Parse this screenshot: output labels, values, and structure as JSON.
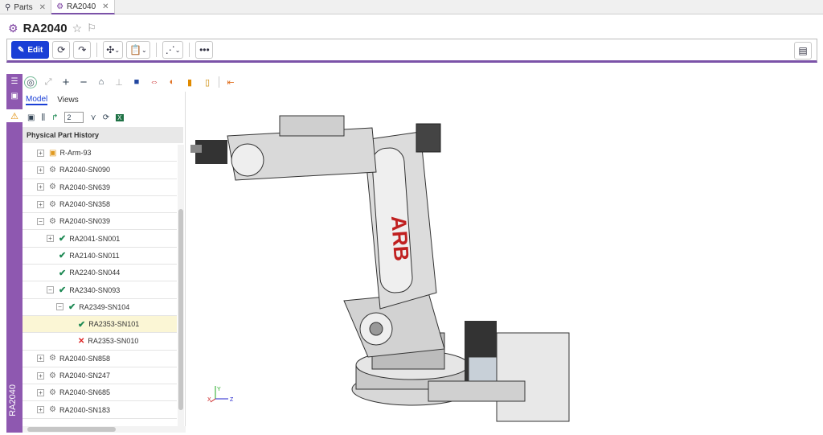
{
  "tabs": [
    {
      "label": "Parts",
      "icon": "search-icon"
    },
    {
      "label": "RA2040",
      "icon": "gear-icon"
    }
  ],
  "page": {
    "title": "RA2040"
  },
  "toolbar": {
    "edit_label": "Edit"
  },
  "sidebar": {
    "vertical_label": "RA2040"
  },
  "panel": {
    "tabs": [
      "Model",
      "Views"
    ],
    "level_value": "2",
    "header": "Physical Part History"
  },
  "tree": [
    {
      "label": "R-Arm-93",
      "indent": 0,
      "icon": "document-icon",
      "expander": "+"
    },
    {
      "label": "RA2040-SN090",
      "indent": 0,
      "icon": "part-icon",
      "expander": "+"
    },
    {
      "label": "RA2040-SN639",
      "indent": 0,
      "icon": "part-icon",
      "expander": "+"
    },
    {
      "label": "RA2040-SN358",
      "indent": 0,
      "icon": "part-icon",
      "expander": "+"
    },
    {
      "label": "RA2040-SN039",
      "indent": 0,
      "icon": "part-icon",
      "expander": "-"
    },
    {
      "label": "RA2041-SN001",
      "indent": 1,
      "icon": "check-icon",
      "expander": "+"
    },
    {
      "label": "RA2140-SN011",
      "indent": 1,
      "icon": "check-icon",
      "expander": ""
    },
    {
      "label": "RA2240-SN044",
      "indent": 1,
      "icon": "check-icon",
      "expander": ""
    },
    {
      "label": "RA2340-SN093",
      "indent": 1,
      "icon": "check-icon",
      "expander": "-"
    },
    {
      "label": "RA2349-SN104",
      "indent": 2,
      "icon": "check-icon",
      "expander": "-"
    },
    {
      "label": "RA2353-SN101",
      "indent": 3,
      "icon": "check-icon",
      "expander": "",
      "selected": true
    },
    {
      "label": "RA2353-SN010",
      "indent": 3,
      "icon": "x-icon",
      "expander": ""
    },
    {
      "label": "RA2040-SN858",
      "indent": 0,
      "icon": "part-icon",
      "expander": "+"
    },
    {
      "label": "RA2040-SN247",
      "indent": 0,
      "icon": "part-icon",
      "expander": "+"
    },
    {
      "label": "RA2040-SN685",
      "indent": 0,
      "icon": "part-icon",
      "expander": "+"
    },
    {
      "label": "RA2040-SN183",
      "indent": 0,
      "icon": "part-icon",
      "expander": "+"
    }
  ],
  "viewport": {
    "robot_brand": "ARB",
    "axis_labels": [
      "Y",
      "X",
      "Z"
    ]
  },
  "colors": {
    "accent": "#7b52a8",
    "primary": "#1a3fd6",
    "check": "#1f8a55",
    "error": "#dd2222"
  }
}
